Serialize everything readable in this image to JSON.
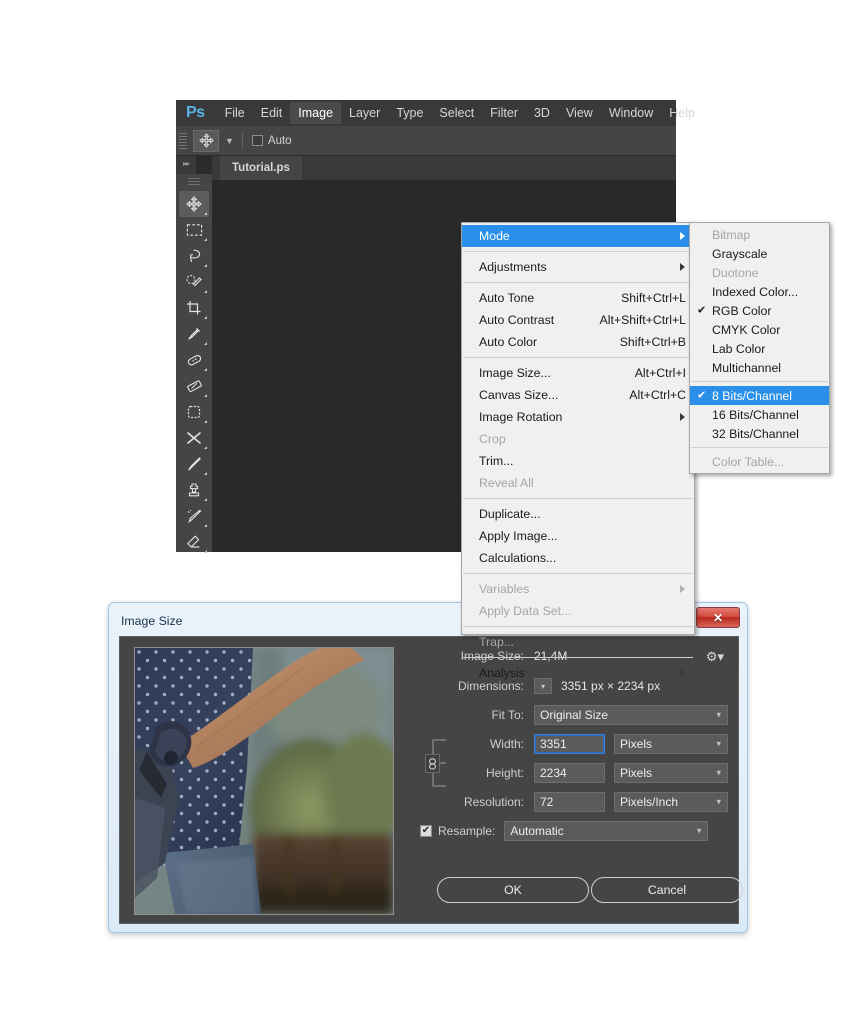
{
  "app": {
    "logo": "Ps",
    "menubar": [
      "File",
      "Edit",
      "Image",
      "Layer",
      "Type",
      "Select",
      "Filter",
      "3D",
      "View",
      "Window",
      "Help"
    ],
    "active_menu": "Image",
    "document_tab": "Tutorial.ps",
    "options_bar": {
      "tool_icon": "move-tool-icon",
      "auto_label": "Auto"
    },
    "tools": [
      {
        "name": "move-tool",
        "selected": true
      },
      {
        "name": "rectangular-marquee-tool",
        "selected": false
      },
      {
        "name": "lasso-tool",
        "selected": false
      },
      {
        "name": "quick-selection-tool",
        "selected": false
      },
      {
        "name": "crop-tool",
        "selected": false
      },
      {
        "name": "eyedropper-tool",
        "selected": false
      },
      {
        "name": "spot-healing-brush-tool",
        "selected": false
      },
      {
        "name": "patch-tool",
        "selected": false
      },
      {
        "name": "content-aware-move-tool",
        "selected": false
      },
      {
        "name": "red-eye-tool",
        "selected": false
      },
      {
        "name": "brush-tool",
        "selected": false
      },
      {
        "name": "clone-stamp-tool",
        "selected": false
      },
      {
        "name": "history-brush-tool",
        "selected": false
      },
      {
        "name": "eraser-tool",
        "selected": false
      }
    ]
  },
  "image_menu": {
    "items": [
      {
        "label": "Mode",
        "shortcut": "",
        "submenu": true,
        "highlighted": true,
        "disabled": false
      },
      {
        "sep": true
      },
      {
        "label": "Adjustments",
        "shortcut": "",
        "submenu": true,
        "highlighted": false,
        "disabled": false
      },
      {
        "sep": true
      },
      {
        "label": "Auto Tone",
        "shortcut": "Shift+Ctrl+L",
        "submenu": false,
        "highlighted": false,
        "disabled": false
      },
      {
        "label": "Auto Contrast",
        "shortcut": "Alt+Shift+Ctrl+L",
        "submenu": false,
        "highlighted": false,
        "disabled": false
      },
      {
        "label": "Auto Color",
        "shortcut": "Shift+Ctrl+B",
        "submenu": false,
        "highlighted": false,
        "disabled": false
      },
      {
        "sep": true
      },
      {
        "label": "Image Size...",
        "shortcut": "Alt+Ctrl+I",
        "submenu": false,
        "highlighted": false,
        "disabled": false
      },
      {
        "label": "Canvas Size...",
        "shortcut": "Alt+Ctrl+C",
        "submenu": false,
        "highlighted": false,
        "disabled": false
      },
      {
        "label": "Image Rotation",
        "shortcut": "",
        "submenu": true,
        "highlighted": false,
        "disabled": false
      },
      {
        "label": "Crop",
        "shortcut": "",
        "submenu": false,
        "highlighted": false,
        "disabled": true
      },
      {
        "label": "Trim...",
        "shortcut": "",
        "submenu": false,
        "highlighted": false,
        "disabled": false
      },
      {
        "label": "Reveal All",
        "shortcut": "",
        "submenu": false,
        "highlighted": false,
        "disabled": true
      },
      {
        "sep": true
      },
      {
        "label": "Duplicate...",
        "shortcut": "",
        "submenu": false,
        "highlighted": false,
        "disabled": false
      },
      {
        "label": "Apply Image...",
        "shortcut": "",
        "submenu": false,
        "highlighted": false,
        "disabled": false
      },
      {
        "label": "Calculations...",
        "shortcut": "",
        "submenu": false,
        "highlighted": false,
        "disabled": false
      },
      {
        "sep": true
      },
      {
        "label": "Variables",
        "shortcut": "",
        "submenu": true,
        "highlighted": false,
        "disabled": true
      },
      {
        "label": "Apply Data Set...",
        "shortcut": "",
        "submenu": false,
        "highlighted": false,
        "disabled": true
      },
      {
        "sep": true
      },
      {
        "label": "Trap...",
        "shortcut": "",
        "submenu": false,
        "highlighted": false,
        "disabled": true
      },
      {
        "sep": true
      },
      {
        "label": "Analysis",
        "shortcut": "",
        "submenu": true,
        "highlighted": false,
        "disabled": false
      }
    ]
  },
  "mode_menu": {
    "items": [
      {
        "label": "Bitmap",
        "checked": false,
        "highlighted": false,
        "disabled": true
      },
      {
        "label": "Grayscale",
        "checked": false,
        "highlighted": false,
        "disabled": false
      },
      {
        "label": "Duotone",
        "checked": false,
        "highlighted": false,
        "disabled": true
      },
      {
        "label": "Indexed Color...",
        "checked": false,
        "highlighted": false,
        "disabled": false
      },
      {
        "label": "RGB Color",
        "checked": true,
        "highlighted": false,
        "disabled": false
      },
      {
        "label": "CMYK Color",
        "checked": false,
        "highlighted": false,
        "disabled": false
      },
      {
        "label": "Lab Color",
        "checked": false,
        "highlighted": false,
        "disabled": false
      },
      {
        "label": "Multichannel",
        "checked": false,
        "highlighted": false,
        "disabled": false
      },
      {
        "sep": true
      },
      {
        "label": "8 Bits/Channel",
        "checked": true,
        "highlighted": true,
        "disabled": false
      },
      {
        "label": "16 Bits/Channel",
        "checked": false,
        "highlighted": false,
        "disabled": false
      },
      {
        "label": "32 Bits/Channel",
        "checked": false,
        "highlighted": false,
        "disabled": false
      },
      {
        "sep": true
      },
      {
        "label": "Color Table...",
        "checked": false,
        "highlighted": false,
        "disabled": true
      }
    ],
    "check_glyph": "✔"
  },
  "dialog": {
    "title": "Image Size",
    "close_glyph": "✕",
    "gear_icon": "gear-icon",
    "image_size_label": "Image Size:",
    "image_size_value": "21,4M",
    "dimensions_label": "Dimensions:",
    "dimensions_value": "3351 px  ×  2234 px",
    "fit_to_label": "Fit To:",
    "fit_to_value": "Original Size",
    "width_label": "Width:",
    "width_value": "3351",
    "width_unit": "Pixels",
    "height_label": "Height:",
    "height_value": "2234",
    "height_unit": "Pixels",
    "resolution_label": "Resolution:",
    "resolution_value": "72",
    "resolution_unit": "Pixels/Inch",
    "resample_label": "Resample:",
    "resample_value": "Automatic",
    "resample_checked": true,
    "chain_icon": "link-constrain-icon",
    "ok_label": "OK",
    "cancel_label": "Cancel"
  },
  "colors": {
    "accent_blue": "#2a8fe8",
    "ps_logo_blue": "#57b3e4",
    "panel_dark": "#454545",
    "canvas_dark": "#292929",
    "menu_light": "#f1f0f0",
    "dialog_chrome": "#dcebf8",
    "close_red": "#c0392b"
  }
}
